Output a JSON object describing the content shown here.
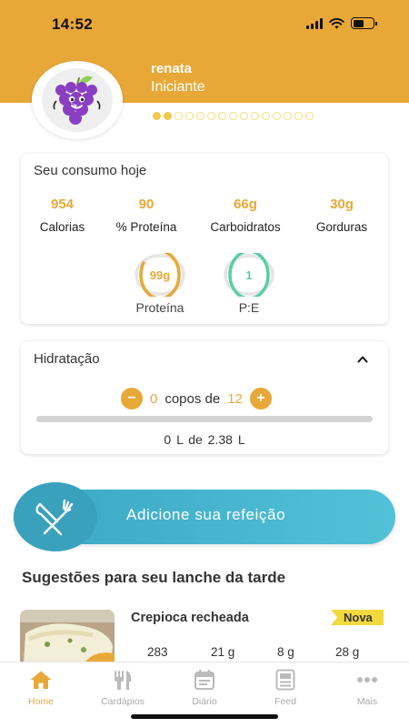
{
  "status": {
    "time": "14:52"
  },
  "profile": {
    "name": "renata",
    "level": "Iniciante",
    "progress_filled": 2,
    "progress_total": 15
  },
  "consumo": {
    "title": "Seu consumo hoje",
    "macros": [
      {
        "value": "954",
        "label": "Calorias"
      },
      {
        "value": "90",
        "label": "% Proteína"
      },
      {
        "value": "66g",
        "label": "Carboidratos"
      },
      {
        "value": "30g",
        "label": "Gorduras"
      }
    ],
    "rings": [
      {
        "value": "99g",
        "label": "Proteína",
        "color": "#E8A838",
        "fill": 0.85
      },
      {
        "value": "1",
        "label": "P:E",
        "color": "#5BCFA0",
        "fill": 1.0
      }
    ]
  },
  "hidratacao": {
    "title": "Hidratação",
    "minus": "−",
    "plus": "+",
    "current": "0",
    "between": "copos de",
    "goal": "12",
    "fill": 0,
    "liters": "0 L  de  2.38 L"
  },
  "add_meal": {
    "label": "Adicione sua refeição"
  },
  "suggestions": {
    "title": "Sugestões para seu lanche da tarde",
    "items": [
      {
        "name": "Crepioca recheada",
        "badge": "Nova",
        "calories": "283",
        "carbs": "21 g",
        "fat": "8 g",
        "protein": "28 g"
      }
    ]
  },
  "tabs": [
    {
      "label": "Home",
      "icon": "home-icon",
      "active": true
    },
    {
      "label": "Cardápios",
      "icon": "cutlery-icon",
      "active": false
    },
    {
      "label": "Diário",
      "icon": "calendar-icon",
      "active": false
    },
    {
      "label": "Feed",
      "icon": "feed-icon",
      "active": false
    },
    {
      "label": "Mais",
      "icon": "more-icon",
      "active": false
    }
  ],
  "colors": {
    "accent": "#E8A838",
    "teal": "#4BB7D0",
    "green": "#5BCFA0"
  }
}
